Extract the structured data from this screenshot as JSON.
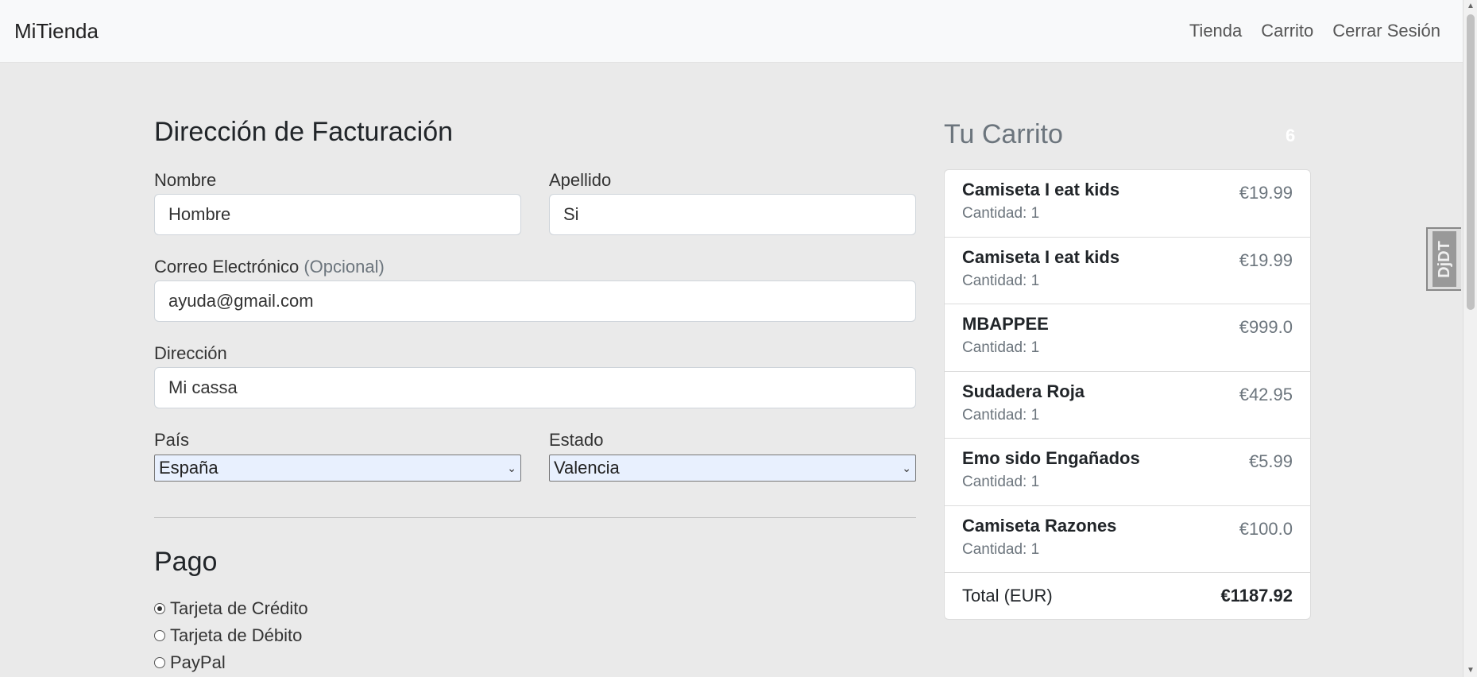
{
  "navbar": {
    "brand": "MiTienda",
    "links": [
      "Tienda",
      "Carrito",
      "Cerrar Sesión"
    ]
  },
  "billing": {
    "title": "Dirección de Facturación",
    "first_name": {
      "label": "Nombre",
      "value": "Hombre"
    },
    "last_name": {
      "label": "Apellido",
      "value": "Si"
    },
    "email": {
      "label": "Correo Electrónico",
      "optional": "(Opcional)",
      "value": "ayuda@gmail.com"
    },
    "address": {
      "label": "Dirección",
      "value": "Mi cassa"
    },
    "country": {
      "label": "País",
      "value": "España"
    },
    "state": {
      "label": "Estado",
      "value": "Valencia"
    }
  },
  "payment": {
    "title": "Pago",
    "options": [
      {
        "label": "Tarjeta de Crédito",
        "checked": true
      },
      {
        "label": "Tarjeta de Débito",
        "checked": false
      },
      {
        "label": "PayPal",
        "checked": false
      }
    ]
  },
  "cart": {
    "title": "Tu Carrito",
    "count": "6",
    "items": [
      {
        "name": "Camiseta I eat kids",
        "qty": "Cantidad: 1",
        "price": "€19.99"
      },
      {
        "name": "Camiseta I eat kids",
        "qty": "Cantidad: 1",
        "price": "€19.99"
      },
      {
        "name": "MBAPPEE",
        "qty": "Cantidad: 1",
        "price": "€999.0"
      },
      {
        "name": "Sudadera Roja",
        "qty": "Cantidad: 1",
        "price": "€42.95"
      },
      {
        "name": "Emo sido Engañados",
        "qty": "Cantidad: 1",
        "price": "€5.99"
      },
      {
        "name": "Camiseta Razones",
        "qty": "Cantidad: 1",
        "price": "€100.0"
      }
    ],
    "total_label": "Total (EUR)",
    "total_value": "€1187.92"
  },
  "debug_toolbar": {
    "label": "DjDT"
  }
}
